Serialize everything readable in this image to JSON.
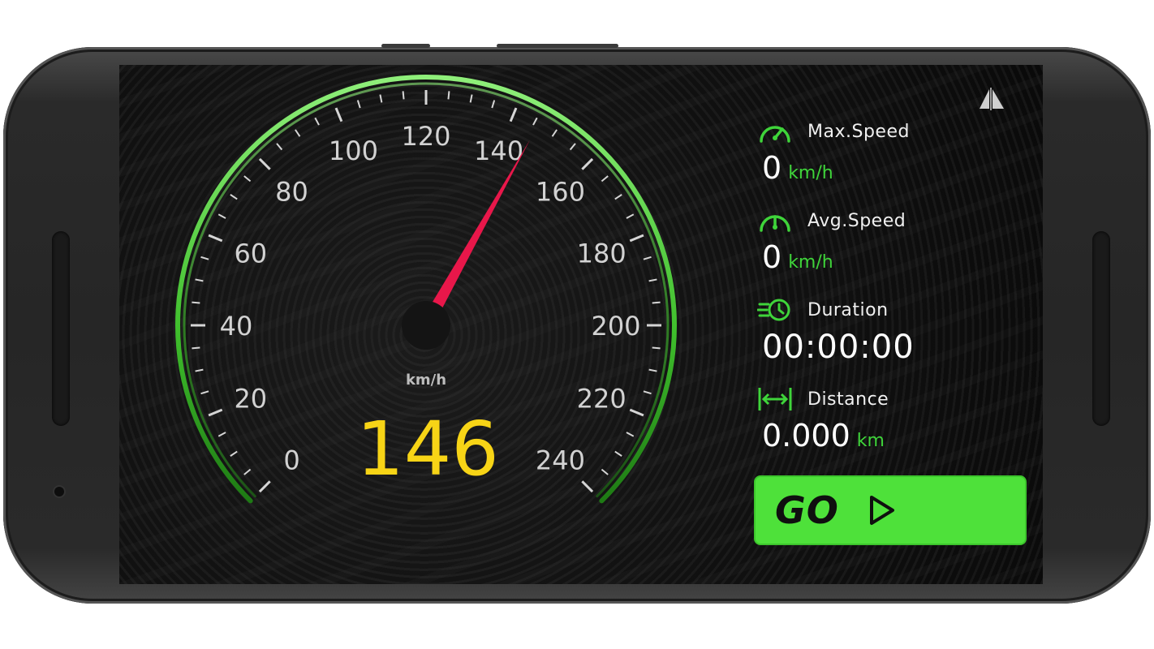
{
  "gauge": {
    "unit": "km/h",
    "current_speed": "146",
    "needle_value": 146,
    "scale_min": 0,
    "scale_max": 240,
    "tick_labels": [
      "0",
      "20",
      "40",
      "60",
      "80",
      "100",
      "120",
      "140",
      "160",
      "180",
      "200",
      "220",
      "240"
    ]
  },
  "stats": {
    "max_speed": {
      "label": "Max.Speed",
      "value": "0",
      "unit": "km/h"
    },
    "avg_speed": {
      "label": "Avg.Speed",
      "value": "0",
      "unit": "km/h"
    },
    "duration": {
      "label": "Duration",
      "value": "00:00:00"
    },
    "distance": {
      "label": "Distance",
      "value": "0.000",
      "unit": "km"
    }
  },
  "go_button": {
    "label": "GO"
  },
  "colors": {
    "accent_green": "#4ee13a",
    "needle_red": "#e8174a",
    "speed_yellow": "#f7d416"
  },
  "icons": {
    "max_speed": "speedometer-icon",
    "avg_speed": "speedometer-icon",
    "duration": "timer-icon",
    "distance": "distance-arrows-icon",
    "top_right": "mirror-icon",
    "go": "play-icon"
  }
}
